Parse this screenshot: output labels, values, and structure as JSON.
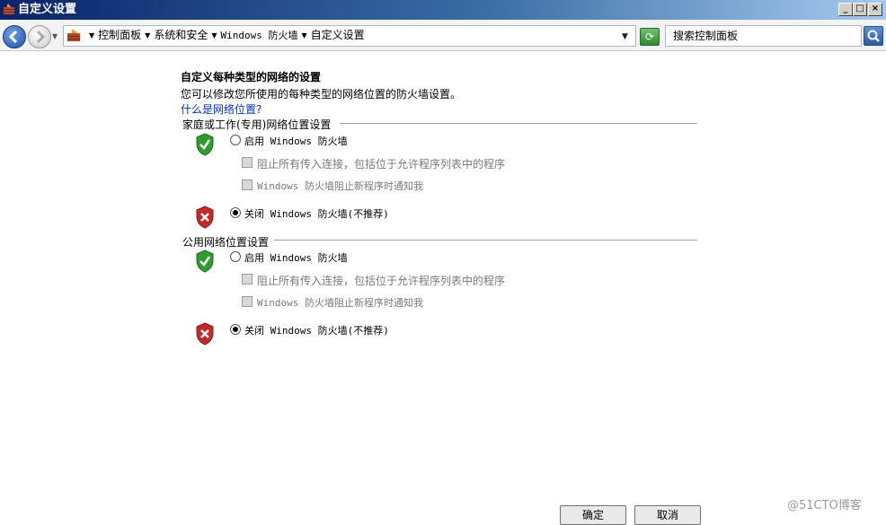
{
  "window": {
    "title": "自定义设置",
    "minimize_glyph": "_",
    "maximize_glyph": "□",
    "close_glyph": "×"
  },
  "nav": {
    "breadcrumbs": [
      "控制面板",
      "系统和安全",
      "Windows 防火墙",
      "自定义设置"
    ],
    "search_placeholder": "搜索控制面板"
  },
  "page": {
    "heading": "自定义每种类型的网络的设置",
    "description": "您可以修改您所使用的每种类型的网络位置的防火墙设置。",
    "help_link": "什么是网络位置?"
  },
  "sections": [
    {
      "title": "家庭或工作(专用)网络位置设置",
      "enable_label": "启用 Windows 防火墙",
      "enable_selected": false,
      "block_all_label": "阻止所有传入连接，包括位于允许程序列表中的程序",
      "notify_label": "Windows 防火墙阻止新程序时通知我",
      "disable_label": "关闭 Windows 防火墙(不推荐)",
      "disable_selected": true
    },
    {
      "title": "公用网络位置设置",
      "enable_label": "启用 Windows 防火墙",
      "enable_selected": false,
      "block_all_label": "阻止所有传入连接，包括位于允许程序列表中的程序",
      "notify_label": "Windows 防火墙阻止新程序时通知我",
      "disable_label": "关闭 Windows 防火墙(不推荐)",
      "disable_selected": true
    }
  ],
  "buttons": {
    "ok": "确定",
    "cancel": "取消"
  },
  "watermark": "@51CTO博客",
  "colors": {
    "link": "#0033cc",
    "shield_on": "#2e9d2e",
    "shield_off": "#c62828"
  }
}
